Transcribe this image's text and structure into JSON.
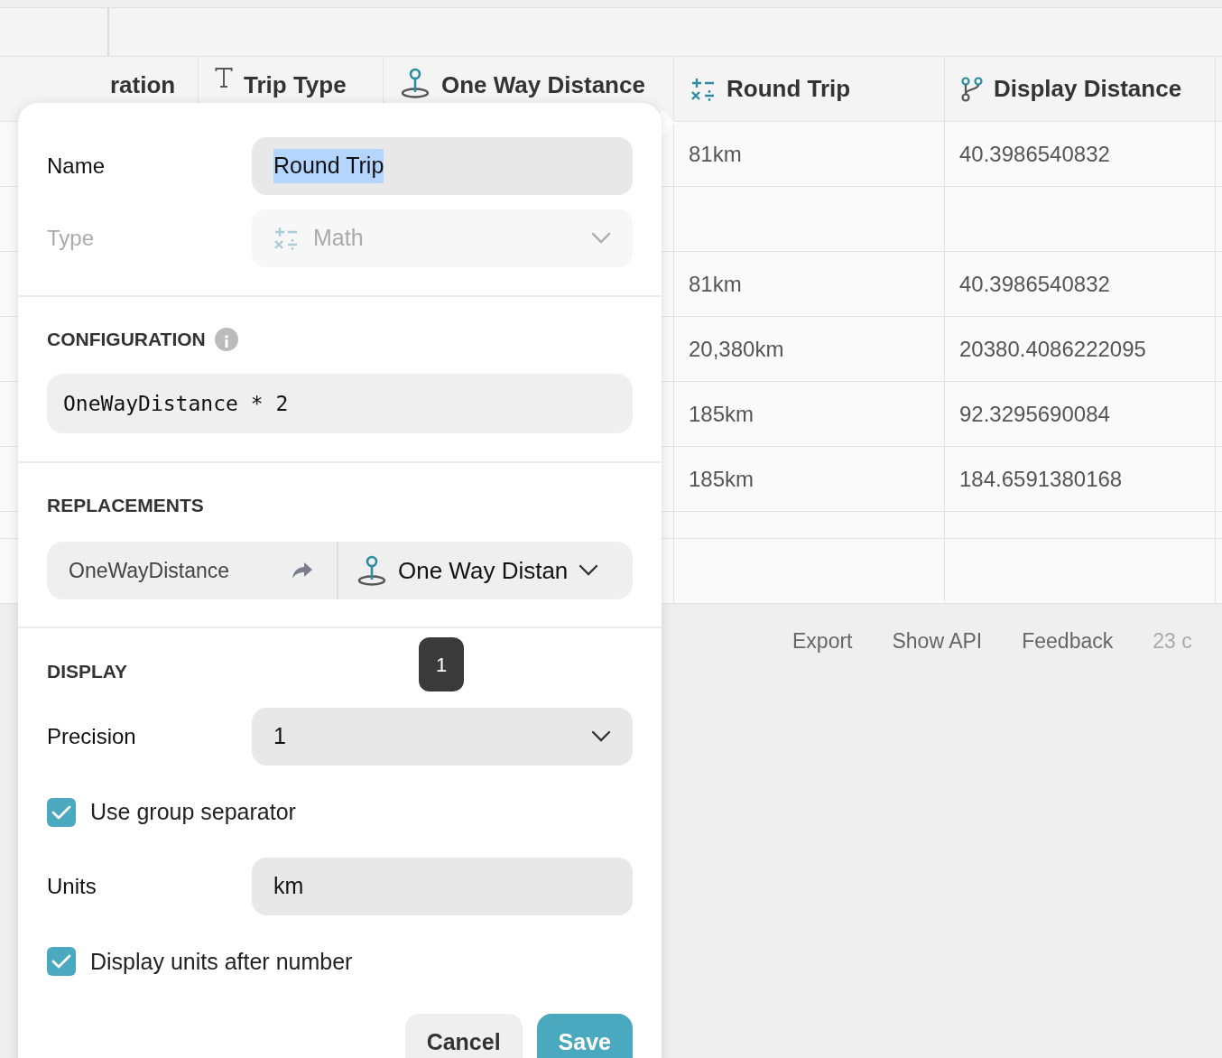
{
  "table": {
    "columns": [
      {
        "label": "ration"
      },
      {
        "label": "Trip Type"
      },
      {
        "label": "One Way Distance"
      },
      {
        "label": "Round Trip"
      },
      {
        "label": "Display Distance"
      }
    ],
    "rows": [
      {
        "kind": "data",
        "cells": [
          "81km",
          "40.3986540832"
        ]
      },
      {
        "kind": "blank"
      },
      {
        "kind": "data",
        "cells": [
          "81km",
          "40.3986540832"
        ]
      },
      {
        "kind": "data",
        "cells": [
          "20,380km",
          "20380.4086222095"
        ]
      },
      {
        "kind": "data",
        "cells": [
          "185km",
          "92.3295690084"
        ]
      },
      {
        "kind": "data",
        "cells": [
          "185km",
          "184.6591380168"
        ]
      },
      {
        "kind": "spacer"
      },
      {
        "kind": "blank"
      }
    ]
  },
  "footer": {
    "links": [
      "Export",
      "Show API",
      "Feedback"
    ],
    "count": "23 c"
  },
  "popover": {
    "name": {
      "label": "Name",
      "value": "Round Trip",
      "text_selected": true
    },
    "type": {
      "label": "Type",
      "value": "Math",
      "disabled": true
    },
    "configuration": {
      "title": "CONFIGURATION",
      "formula": "OneWayDistance * 2"
    },
    "replacements": {
      "title": "REPLACEMENTS",
      "variable": "OneWayDistance",
      "column": "One Way Distan"
    },
    "display": {
      "title": "DISPLAY",
      "precision_label": "Precision",
      "precision": "1",
      "group_separator": {
        "label": "Use group separator",
        "checked": true
      },
      "units_label": "Units",
      "units": "km",
      "units_after": {
        "label": "Display units after number",
        "checked": true
      }
    },
    "buttons": [
      "Cancel",
      "Save"
    ]
  },
  "tooltip": "1"
}
